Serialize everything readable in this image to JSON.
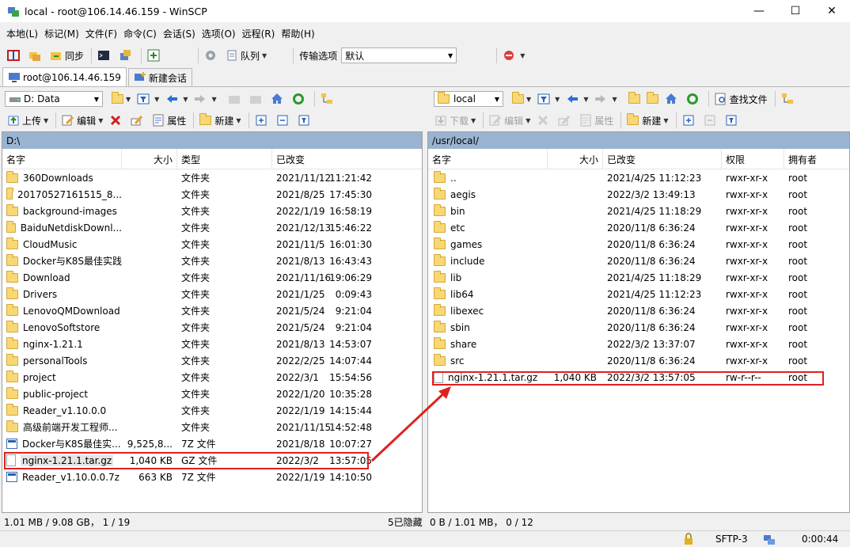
{
  "window": {
    "title": "local - root@106.14.46.159 - WinSCP",
    "minimize": "—",
    "maximize": "☐",
    "close": "✕"
  },
  "menu": [
    "本地(L)",
    "标记(M)",
    "文件(F)",
    "命令(C)",
    "会话(S)",
    "选项(O)",
    "远程(R)",
    "帮助(H)"
  ],
  "toolbar": {
    "sync_label": "同步",
    "queue_label": "队列",
    "transfer_options_label": "传输选项",
    "transfer_preset": "默认"
  },
  "sessions": {
    "active": "root@106.14.46.159",
    "new_session": "新建会话"
  },
  "left": {
    "drive": "D: Data",
    "upload_label": "上传",
    "edit_label": "编辑",
    "properties_label": "属性",
    "new_label": "新建",
    "path": "D:\\",
    "columns": [
      "名字",
      "大小",
      "类型",
      "已改变"
    ],
    "rows": [
      {
        "name": "360Downloads",
        "size": "",
        "type": "文件夹",
        "date": "2021/11/12",
        "time": "11:21:42",
        "kind": "folder"
      },
      {
        "name": "20170527161515_8...",
        "size": "",
        "type": "文件夹",
        "date": "2021/8/25",
        "time": "17:45:30",
        "kind": "folder"
      },
      {
        "name": "background-images",
        "size": "",
        "type": "文件夹",
        "date": "2022/1/19",
        "time": "16:58:19",
        "kind": "folder"
      },
      {
        "name": "BaiduNetdiskDownl...",
        "size": "",
        "type": "文件夹",
        "date": "2021/12/13",
        "time": "15:46:22",
        "kind": "folder"
      },
      {
        "name": "CloudMusic",
        "size": "",
        "type": "文件夹",
        "date": "2021/11/5",
        "time": "16:01:30",
        "kind": "folder"
      },
      {
        "name": "Docker与K8S最佳实践",
        "size": "",
        "type": "文件夹",
        "date": "2021/8/13",
        "time": "16:43:43",
        "kind": "folder"
      },
      {
        "name": "Download",
        "size": "",
        "type": "文件夹",
        "date": "2021/11/16",
        "time": "19:06:29",
        "kind": "folder"
      },
      {
        "name": "Drivers",
        "size": "",
        "type": "文件夹",
        "date": "2021/1/25",
        "time": "0:09:43",
        "kind": "folder"
      },
      {
        "name": "LenovoQMDownload",
        "size": "",
        "type": "文件夹",
        "date": "2021/5/24",
        "time": "9:21:04",
        "kind": "folder"
      },
      {
        "name": "LenovoSoftstore",
        "size": "",
        "type": "文件夹",
        "date": "2021/5/24",
        "time": "9:21:04",
        "kind": "folder"
      },
      {
        "name": "nginx-1.21.1",
        "size": "",
        "type": "文件夹",
        "date": "2021/8/13",
        "time": "14:53:07",
        "kind": "folder"
      },
      {
        "name": "personalTools",
        "size": "",
        "type": "文件夹",
        "date": "2022/2/25",
        "time": "14:07:44",
        "kind": "folder"
      },
      {
        "name": "project",
        "size": "",
        "type": "文件夹",
        "date": "2022/3/1",
        "time": "15:54:56",
        "kind": "folder"
      },
      {
        "name": "public-project",
        "size": "",
        "type": "文件夹",
        "date": "2022/1/20",
        "time": "10:35:28",
        "kind": "folder"
      },
      {
        "name": "Reader_v1.10.0.0",
        "size": "",
        "type": "文件夹",
        "date": "2022/1/19",
        "time": "14:15:44",
        "kind": "folder"
      },
      {
        "name": "高级前端开发工程师...",
        "size": "",
        "type": "文件夹",
        "date": "2021/11/15",
        "time": "14:52:48",
        "kind": "folder"
      },
      {
        "name": "Docker与K8S最佳实...",
        "size": "9,525,8...",
        "type": "7Z 文件",
        "date": "2021/8/18",
        "time": "10:07:27",
        "kind": "zip"
      },
      {
        "name": "nginx-1.21.1.tar.gz",
        "size": "1,040 KB",
        "type": "GZ 文件",
        "date": "2022/3/2",
        "time": "13:57:05",
        "kind": "file"
      },
      {
        "name": "Reader_v1.10.0.0.7z",
        "size": "663 KB",
        "type": "7Z 文件",
        "date": "2022/1/19",
        "time": "14:10:50",
        "kind": "zip"
      }
    ],
    "status_sel": "1.01 MB / 9.08 GB， 1 / 19",
    "status_hidden": "5已隐藏"
  },
  "right": {
    "location": "local",
    "download_label": "下载",
    "edit_label": "编辑",
    "properties_label": "属性",
    "new_label": "新建",
    "find_label": "查找文件",
    "path": "/usr/local/",
    "columns": [
      "名字",
      "大小",
      "已改变",
      "权限",
      "拥有者"
    ],
    "rows": [
      {
        "name": "..",
        "size": "",
        "date": "2021/4/25 11:12:23",
        "rights": "rwxr-xr-x",
        "owner": "root",
        "kind": "up"
      },
      {
        "name": "aegis",
        "size": "",
        "date": "2022/3/2 13:49:13",
        "rights": "rwxr-xr-x",
        "owner": "root",
        "kind": "folder"
      },
      {
        "name": "bin",
        "size": "",
        "date": "2021/4/25 11:18:29",
        "rights": "rwxr-xr-x",
        "owner": "root",
        "kind": "folder"
      },
      {
        "name": "etc",
        "size": "",
        "date": "2020/11/8 6:36:24",
        "rights": "rwxr-xr-x",
        "owner": "root",
        "kind": "folder"
      },
      {
        "name": "games",
        "size": "",
        "date": "2020/11/8 6:36:24",
        "rights": "rwxr-xr-x",
        "owner": "root",
        "kind": "folder"
      },
      {
        "name": "include",
        "size": "",
        "date": "2020/11/8 6:36:24",
        "rights": "rwxr-xr-x",
        "owner": "root",
        "kind": "folder"
      },
      {
        "name": "lib",
        "size": "",
        "date": "2021/4/25 11:18:29",
        "rights": "rwxr-xr-x",
        "owner": "root",
        "kind": "folder"
      },
      {
        "name": "lib64",
        "size": "",
        "date": "2021/4/25 11:12:23",
        "rights": "rwxr-xr-x",
        "owner": "root",
        "kind": "folder"
      },
      {
        "name": "libexec",
        "size": "",
        "date": "2020/11/8 6:36:24",
        "rights": "rwxr-xr-x",
        "owner": "root",
        "kind": "folder"
      },
      {
        "name": "sbin",
        "size": "",
        "date": "2020/11/8 6:36:24",
        "rights": "rwxr-xr-x",
        "owner": "root",
        "kind": "folder"
      },
      {
        "name": "share",
        "size": "",
        "date": "2022/3/2 13:37:07",
        "rights": "rwxr-xr-x",
        "owner": "root",
        "kind": "folder"
      },
      {
        "name": "src",
        "size": "",
        "date": "2020/11/8 6:36:24",
        "rights": "rwxr-xr-x",
        "owner": "root",
        "kind": "folder"
      },
      {
        "name": "nginx-1.21.1.tar.gz",
        "size": "1,040 KB",
        "date": "2022/3/2 13:57:05",
        "rights": "rw-r--r--",
        "owner": "root",
        "kind": "file"
      }
    ],
    "status_sel": "0 B / 1.01 MB， 0 / 12"
  },
  "bottom": {
    "protocol": "SFTP-3",
    "elapsed": "0:00:44"
  },
  "colors": {
    "path_bar": "#99b4d1",
    "highlight": "#e02020",
    "folder": "#f8d775"
  }
}
